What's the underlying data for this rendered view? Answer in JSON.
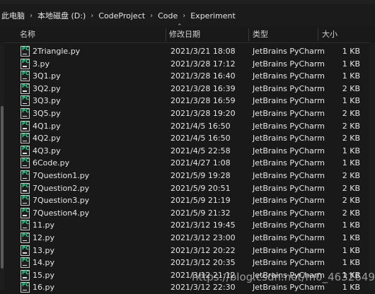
{
  "breadcrumb": {
    "items": [
      "此电脑",
      "本地磁盘 (D:)",
      "CodeProject",
      "Code",
      "Experiment"
    ]
  },
  "columns": {
    "name": "名称",
    "date": "修改日期",
    "type": "类型",
    "size": "大小"
  },
  "files": [
    {
      "name": "2Triangle.py",
      "date": "2021/3/21 18:08",
      "type": "JetBrains PyCharm",
      "size": "1 KB"
    },
    {
      "name": "3.py",
      "date": "2021/3/28 17:12",
      "type": "JetBrains PyCharm",
      "size": "1 KB"
    },
    {
      "name": "3Q1.py",
      "date": "2021/3/28 16:40",
      "type": "JetBrains PyCharm",
      "size": "1 KB"
    },
    {
      "name": "3Q2.py",
      "date": "2021/3/28 16:39",
      "type": "JetBrains PyCharm",
      "size": "2 KB"
    },
    {
      "name": "3Q3.py",
      "date": "2021/3/28 16:59",
      "type": "JetBrains PyCharm",
      "size": "1 KB"
    },
    {
      "name": "3Q5.py",
      "date": "2021/3/28 19:20",
      "type": "JetBrains PyCharm",
      "size": "2 KB"
    },
    {
      "name": "4Q1.py",
      "date": "2021/4/5 16:50",
      "type": "JetBrains PyCharm",
      "size": "2 KB"
    },
    {
      "name": "4Q2.py",
      "date": "2021/4/5 16:50",
      "type": "JetBrains PyCharm",
      "size": "2 KB"
    },
    {
      "name": "4Q3.py",
      "date": "2021/4/5 22:58",
      "type": "JetBrains PyCharm",
      "size": "1 KB"
    },
    {
      "name": "6Code.py",
      "date": "2021/4/27 1:08",
      "type": "JetBrains PyCharm",
      "size": "1 KB"
    },
    {
      "name": "7Question1.py",
      "date": "2021/5/9 19:28",
      "type": "JetBrains PyCharm",
      "size": "2 KB"
    },
    {
      "name": "7Question2.py",
      "date": "2021/5/9 20:51",
      "type": "JetBrains PyCharm",
      "size": "2 KB"
    },
    {
      "name": "7Question3.py",
      "date": "2021/5/9 21:19",
      "type": "JetBrains PyCharm",
      "size": "2 KB"
    },
    {
      "name": "7Question4.py",
      "date": "2021/5/9 21:32",
      "type": "JetBrains PyCharm",
      "size": "2 KB"
    },
    {
      "name": "11.py",
      "date": "2021/3/12 19:45",
      "type": "JetBrains PyCharm",
      "size": "1 KB"
    },
    {
      "name": "12.py",
      "date": "2021/3/12 23:00",
      "type": "JetBrains PyCharm",
      "size": "1 KB"
    },
    {
      "name": "13.py",
      "date": "2021/3/12 20:22",
      "type": "JetBrains PyCharm",
      "size": "1 KB"
    },
    {
      "name": "14.py",
      "date": "2021/3/12 20:35",
      "type": "JetBrains PyCharm",
      "size": "1 KB"
    },
    {
      "name": "15.py",
      "date": "2021/3/12 21:12",
      "type": "JetBrains PyCharm",
      "size": "1 KB"
    },
    {
      "name": "16.py",
      "date": "2021/3/12 22:30",
      "type": "JetBrains PyCharm",
      "size": "1 KB"
    }
  ],
  "watermark": "https://blog.csdn.net/m0_46326495",
  "icon": {
    "name": "pycharm-file-icon",
    "label": "PC",
    "accent": "#21d789"
  }
}
